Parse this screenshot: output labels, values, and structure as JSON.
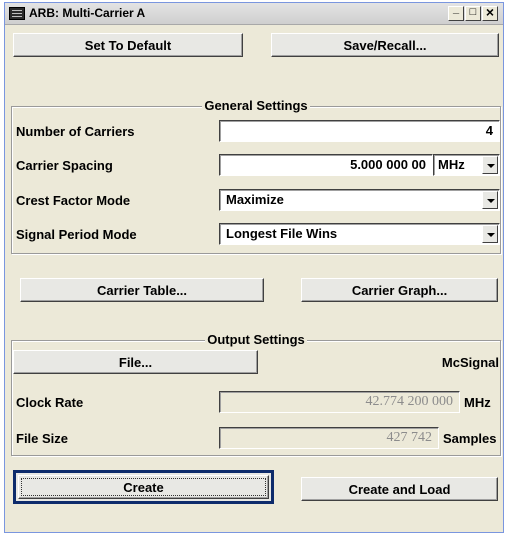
{
  "window": {
    "title": "ARB: Multi-Carrier A"
  },
  "top_buttons": {
    "default_label": "Set To Default",
    "save_recall_label": "Save/Recall..."
  },
  "general": {
    "legend": "General Settings",
    "num_carriers": {
      "label": "Number of Carriers",
      "value": "4"
    },
    "carrier_spacing": {
      "label": "Carrier Spacing",
      "value": "5.000 000 00",
      "unit": "MHz"
    },
    "crest_factor": {
      "label": "Crest Factor Mode",
      "value": "Maximize"
    },
    "signal_period": {
      "label": "Signal Period Mode",
      "value": "Longest File Wins"
    }
  },
  "carrier_buttons": {
    "table_label": "Carrier Table...",
    "graph_label": "Carrier Graph..."
  },
  "output": {
    "legend": "Output Settings",
    "file_label": "File...",
    "file_name": "McSignal",
    "clock_rate": {
      "label": "Clock Rate",
      "value": "42.774 200 000",
      "unit": "MHz"
    },
    "file_size": {
      "label": "File Size",
      "value": "427 742",
      "unit": "Samples"
    }
  },
  "bottom_buttons": {
    "create_label": "Create",
    "create_load_label": "Create and Load"
  }
}
